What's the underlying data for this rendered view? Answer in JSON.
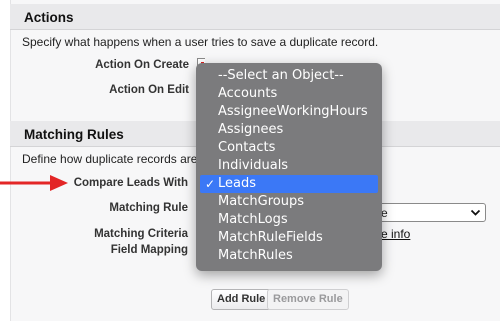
{
  "actions": {
    "title": "Actions",
    "description": "Specify what happens when a user tries to save a duplicate record.",
    "action_on_create_label": "Action On Create",
    "action_on_edit_label": "Action On Edit"
  },
  "matching_rules": {
    "title": "Matching Rules",
    "description": "Define how duplicate records are ic",
    "compare_with_label": "Compare Leads With",
    "matching_rule_label": "Matching Rule",
    "matching_rule_value": "e",
    "matching_criteria_label": "Matching Criteria",
    "field_mapping_label": "Field Mapping",
    "more_info_link": "re info",
    "add_rule_button": "Add Rule",
    "remove_rule_button": "Remove Rule"
  },
  "object_dropdown": {
    "options": [
      "--Select an Object--",
      "Accounts",
      "AssigneeWorkingHours",
      "Assignees",
      "Contacts",
      "Individuals",
      "Leads",
      "MatchGroups",
      "MatchLogs",
      "MatchRuleFields",
      "MatchRules"
    ],
    "selected": "Leads",
    "check_glyph": "✓"
  },
  "colors": {
    "section_header_bg": "#e9e9eb",
    "dropdown_bg": "#7b7b7d",
    "selected_bg": "#3b78f6",
    "arrow": "#e32626"
  }
}
